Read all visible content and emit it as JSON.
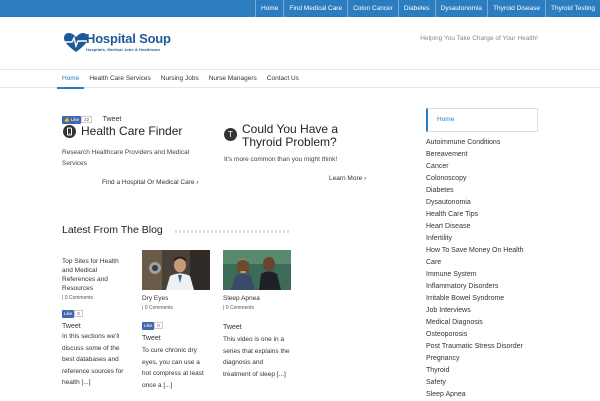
{
  "topnav": [
    "Home",
    "Find Medical Care",
    "Colon Cancer",
    "Diabetes",
    "Dysautonomia",
    "Thyroid Disease",
    "Thyroid Testing"
  ],
  "logo": {
    "title": "Hospital Soup",
    "subtitle": "Hospitals, Medical Jobs & Healthcare"
  },
  "tagline": "Helping You Take Charge of Your Health!",
  "mainnav": [
    {
      "label": "Home",
      "active": true
    },
    {
      "label": "Health Care Services"
    },
    {
      "label": "Nursing Jobs"
    },
    {
      "label": "Nurse Managers"
    },
    {
      "label": "Contact Us"
    }
  ],
  "social": {
    "like_label": "Like",
    "like_count": "22",
    "tweet_label": "Tweet"
  },
  "features": [
    {
      "icon": "phone-icon",
      "title": "Health Care Finder",
      "text": "Research Healthcare Providers and Medical Services",
      "link": "Find a Hospital Or Medical Care ›"
    },
    {
      "icon": "thyroid-t-icon",
      "icon_glyph": "T",
      "title_line1": "Could You Have a",
      "title_line2": "Thyroid Problem?",
      "text": "It's more common than you might think!",
      "link": "Learn More ›"
    }
  ],
  "blog": {
    "heading": "Latest From The Blog",
    "posts": [
      {
        "title": "Top Sites for Health and Medical References and Resources",
        "meta": "| 0 Comments",
        "like_label": "Like",
        "like_count": "0",
        "tweet_label": "Tweet",
        "excerpt": "In this sections we'll discuss some of the best databases and reference sources for health [...]"
      },
      {
        "title": "Dry Eyes",
        "meta": "| 0 Comments",
        "like_label": "Like",
        "like_count": "0",
        "tweet_label": "Tweet",
        "excerpt": "To cure chronic dry eyes, you can use a hot compress at least once a [...]"
      },
      {
        "title": "Sleep Apnea",
        "meta": "| 0 Comments",
        "tweet_label": "Tweet",
        "excerpt": "This video is one in a series that explains the diagnosis and treatment of sleep [...]"
      }
    ]
  },
  "sidebar": {
    "home": "Home",
    "items": [
      "Autoimmune Conditions",
      "Bereavement",
      "Cancer",
      "Colonoscopy",
      "Diabetes",
      "Dysautonomia",
      "Health Care Tips",
      "Heart Disease",
      "Infertility",
      "How To Save Money On Health Care",
      "Immune System",
      "Inflammatory Disorders",
      "Irritable Bowel Syndrome",
      "Job Interviews",
      "Medical Diagnosis",
      "Osteoporosis",
      "Post Traumatic Stress Disorder",
      "Pregnancy",
      "Thyroid",
      "Safety",
      "Sleep Apnea"
    ]
  },
  "colors": {
    "brand_blue": "#2c7dc0",
    "logo_blue": "#1f5a96",
    "facebook_blue": "#4267b2"
  }
}
